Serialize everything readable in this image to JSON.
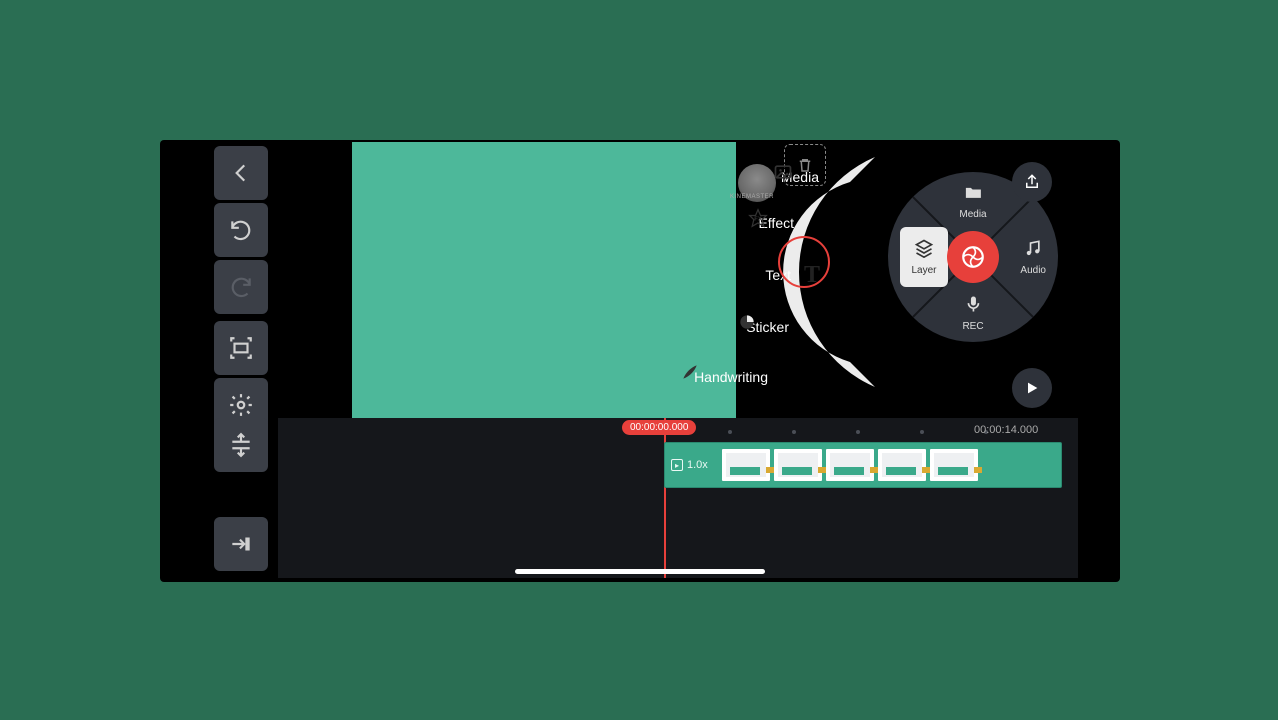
{
  "submenu": {
    "media": "Media",
    "effect": "Effect",
    "text": "Text",
    "sticker": "Sticker",
    "handwriting": "Handwriting"
  },
  "wheel": {
    "media": "Media",
    "audio": "Audio",
    "rec": "REC",
    "layer": "Layer"
  },
  "watermark": "KINEMASTER",
  "timeline": {
    "playhead_time": "00:00:00.000",
    "end_time": "00:00:14.000",
    "clip_speed": "1.0x"
  },
  "colors": {
    "page_bg": "#2a6e53",
    "preview_green": "#4db89a",
    "accent_red": "#e7403b",
    "clip_teal": "#3aa98a",
    "panel_dark": "#15171b",
    "btn_dark": "#2e323a",
    "sidebar_btn": "#3b3f47"
  },
  "icons": {
    "back": "chevron-left-icon",
    "undo": "undo-icon",
    "redo": "redo-icon",
    "capture": "capture-frame-icon",
    "settings": "gear-icon",
    "split_track": "split-track-icon",
    "jump_end": "jump-to-end-icon",
    "share": "share-icon",
    "play": "play-icon",
    "trash": "trash-icon",
    "shutter": "shutter-icon",
    "folder": "folder-icon",
    "music": "music-note-icon",
    "mic": "mic-icon",
    "layers": "layers-icon",
    "img": "image-icon",
    "fx": "fx-icon",
    "t": "text-t-icon",
    "stk": "sticker-shape-icon",
    "pen": "pen-icon"
  }
}
